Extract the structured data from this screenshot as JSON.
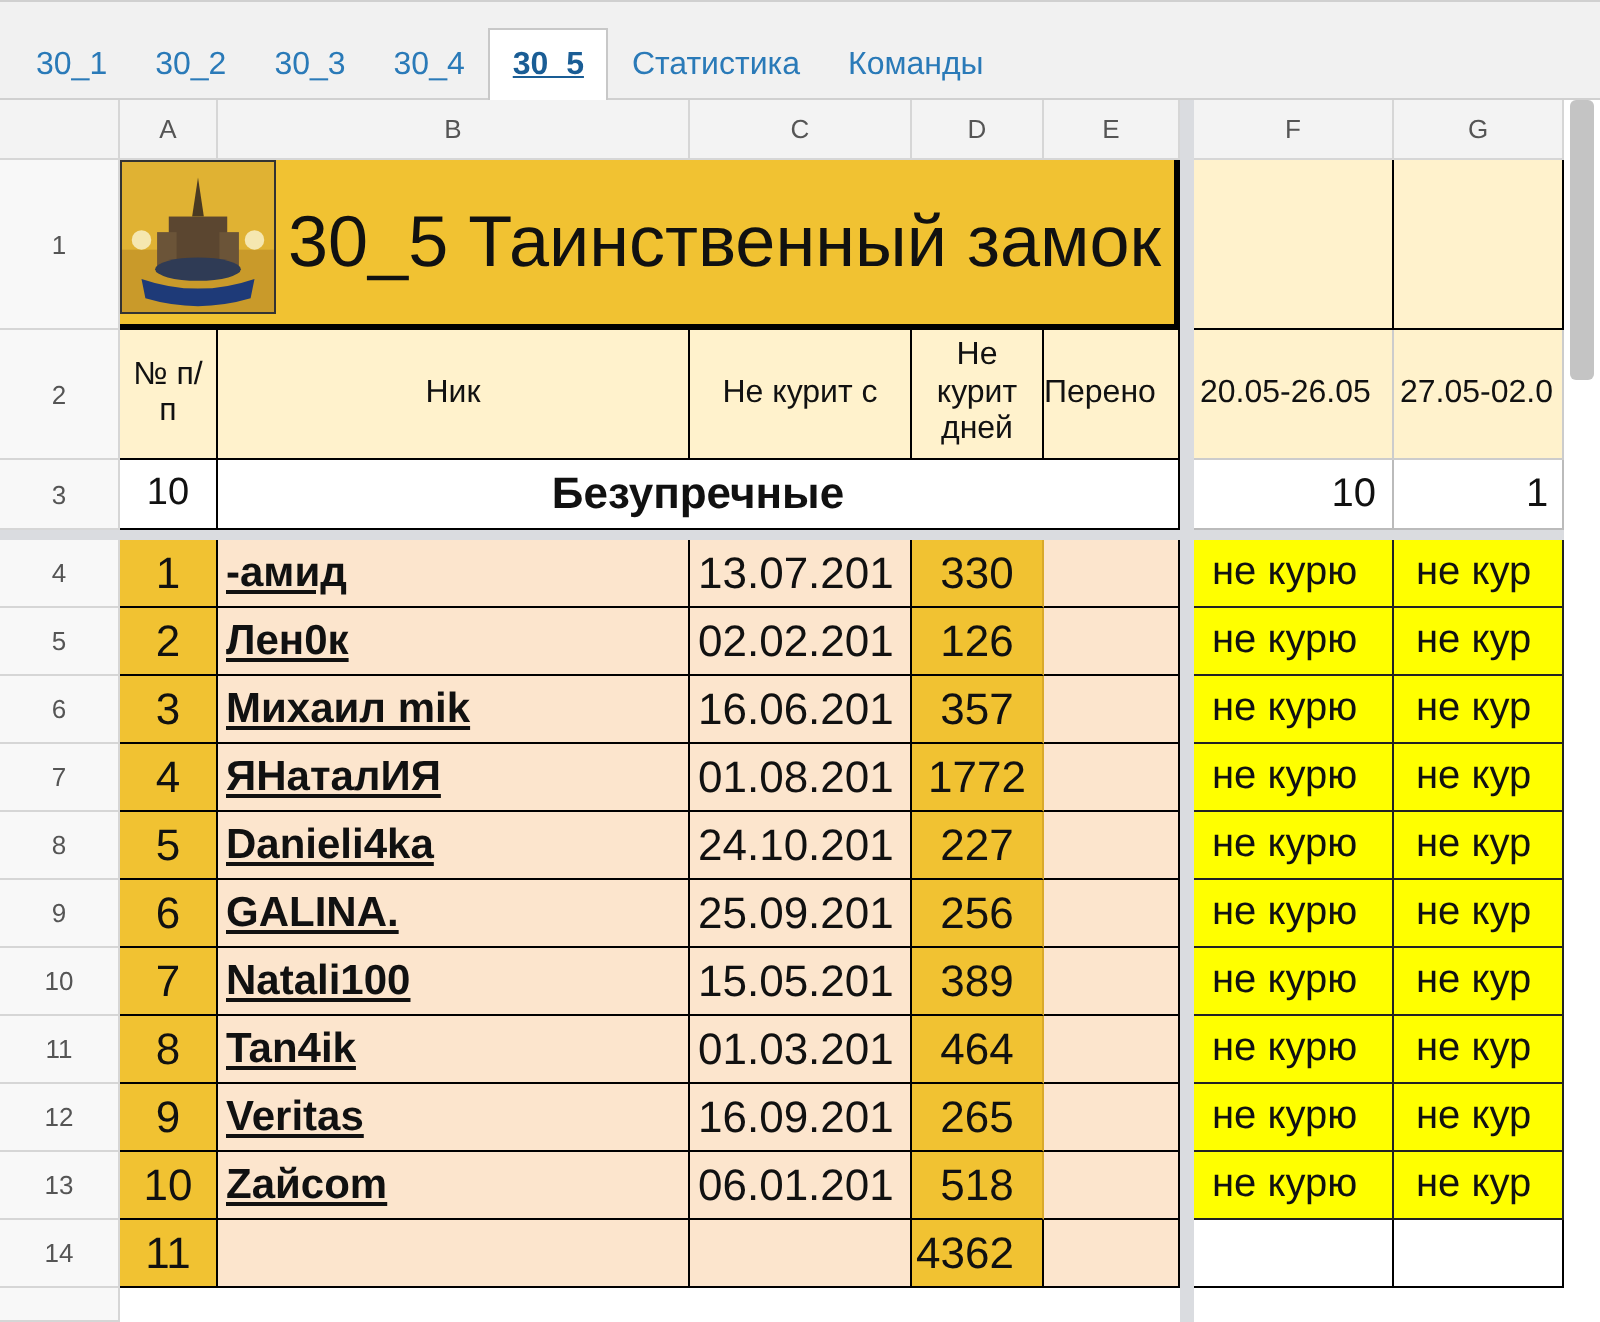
{
  "tabs": [
    {
      "label": "30_1",
      "selected": false
    },
    {
      "label": "30_2",
      "selected": false
    },
    {
      "label": "30_3",
      "selected": false
    },
    {
      "label": "30_4",
      "selected": false
    },
    {
      "label": "30_5",
      "selected": true
    },
    {
      "label": "Статистика",
      "selected": false
    },
    {
      "label": "Команды",
      "selected": false
    }
  ],
  "columns": [
    "A",
    "B",
    "C",
    "D",
    "E",
    "F",
    "G"
  ],
  "row_numbers": [
    "1",
    "2",
    "3",
    "4",
    "5",
    "6",
    "7",
    "8",
    "9",
    "10",
    "11",
    "12",
    "13",
    "14"
  ],
  "title": "30_5 Таинственный замок",
  "header": {
    "number": "№ п/п",
    "nick": "Ник",
    "since": "Не курит с",
    "days": "Не курит дней",
    "transfer": "Перено",
    "weeks": [
      "20.05-26.05",
      "27.05-02.0"
    ]
  },
  "group": {
    "count": "10",
    "name": "Безупречные",
    "weeks": [
      "10",
      "1"
    ]
  },
  "rows": [
    {
      "number": "1",
      "nick": "-амид",
      "since": "13.07.201",
      "days": "330",
      "weeks": [
        "не курю",
        "не кур"
      ]
    },
    {
      "number": "2",
      "nick": "Лен0к",
      "since": "02.02.201",
      "days": "126",
      "weeks": [
        "не курю",
        "не кур"
      ]
    },
    {
      "number": "3",
      "nick": "Михаил mik",
      "since": "16.06.201",
      "days": "357",
      "weeks": [
        "не курю",
        "не кур"
      ]
    },
    {
      "number": "4",
      "nick": "ЯНаталИЯ",
      "since": "01.08.201",
      "days": "1772",
      "weeks": [
        "не курю",
        "не кур"
      ]
    },
    {
      "number": "5",
      "nick": "Danieli4ka",
      "since": "24.10.201",
      "days": "227",
      "weeks": [
        "не курю",
        "не кур"
      ]
    },
    {
      "number": "6",
      "nick": "GALINA.",
      "since": "25.09.201",
      "days": "256",
      "weeks": [
        "не курю",
        "не кур"
      ]
    },
    {
      "number": "7",
      "nick": "Natali100",
      "since": "15.05.201",
      "days": "389",
      "weeks": [
        "не курю",
        "не кур"
      ]
    },
    {
      "number": "8",
      "nick": "Tan4ik",
      "since": "01.03.201",
      "days": "464",
      "weeks": [
        "не курю",
        "не кур"
      ]
    },
    {
      "number": "9",
      "nick": "Veritas",
      "since": "16.09.201",
      "days": "265",
      "weeks": [
        "не курю",
        "не кур"
      ]
    },
    {
      "number": "10",
      "nick": "Zайcom",
      "since": "06.01.201",
      "days": "518",
      "weeks": [
        "не курю",
        "не кур"
      ]
    }
  ],
  "total": {
    "number": "11",
    "days": "4362"
  }
}
